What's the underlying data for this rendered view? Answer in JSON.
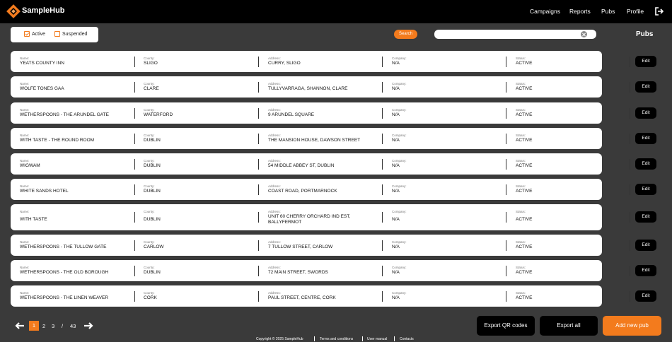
{
  "brand": {
    "name": "SampleHub",
    "accent": "#f37b1d"
  },
  "nav": {
    "items": [
      "Campaigns",
      "Reports",
      "Pubs",
      "Profile"
    ],
    "logout_icon": "logout-icon"
  },
  "filters": {
    "active_label": "Active",
    "active_checked": true,
    "suspended_label": "Suspended",
    "suspended_checked": false
  },
  "search": {
    "button_label": "Search",
    "value": "",
    "placeholder": ""
  },
  "page_title": "Pubs",
  "columns": {
    "name": "Name:",
    "county": "County:",
    "address": "Address:",
    "company": "Company:",
    "status": "Status:"
  },
  "edit_label": "Edit",
  "rows": [
    {
      "name": "YEATS COUNTY INN",
      "county": "SLIGO",
      "address": "CURRY, SLIGO",
      "company": "N/A",
      "status": "ACTIVE"
    },
    {
      "name": "WOLFE TONES GAA",
      "county": "CLARE",
      "address": "TULLYVARRAGA, SHANNON, CLARE",
      "company": "N/A",
      "status": "ACTIVE"
    },
    {
      "name": "WETHERSPOONS - THE ARUNDEL GATE",
      "county": "WATERFORD",
      "address": "9 ARUNDEL SQUARE",
      "company": "N/A",
      "status": "ACTIVE"
    },
    {
      "name": "WITH TASTE - THE ROUND ROOM",
      "county": "DUBLIN",
      "address": "THE MANSION HOUSE, DAWSON STREET",
      "company": "N/A",
      "status": "ACTIVE"
    },
    {
      "name": "WIGWAM",
      "county": "DUBLIN",
      "address": "54 MIDDLE ABBEY ST, DUBLIN",
      "company": "N/A",
      "status": "ACTIVE"
    },
    {
      "name": "WHITE SANDS HOTEL",
      "county": "DUBLIN",
      "address": "COAST ROAD, PORTMARNOCK",
      "company": "N/A",
      "status": "ACTIVE"
    },
    {
      "name": "WITH TASTE",
      "county": "DUBLIN",
      "address": "UNIT 60 CHERRY ORCHARD IND EST, BALLYFERMOT",
      "company": "N/A",
      "status": "ACTIVE"
    },
    {
      "name": "WETHERSPOONS - THE TULLOW GATE",
      "county": "CARLOW",
      "address": "7 TULLOW STREET, CARLOW",
      "company": "N/A",
      "status": "ACTIVE"
    },
    {
      "name": "WETHERSPOONS - THE OLD BOROUGH",
      "county": "DUBLIN",
      "address": "72 MAIN STREET, SWORDS",
      "company": "N/A",
      "status": "ACTIVE"
    },
    {
      "name": "WETHERSPOONS - THE LINEN WEAVER",
      "county": "CORK",
      "address": "PAUL STREET, CENTRE, CORK",
      "company": "N/A",
      "status": "ACTIVE"
    }
  ],
  "pagination": {
    "current": "1",
    "next1": "2",
    "next2": "3",
    "separator": "/",
    "total": "43"
  },
  "actions": {
    "export_qr": "Export QR codes",
    "export_all": "Export all",
    "add_new": "Add new pub"
  },
  "footer": {
    "copyright": "Copyright © 2025 SampleHub",
    "terms": "Terms and conditions",
    "manual": "User manual",
    "contacts": "Contacts"
  }
}
